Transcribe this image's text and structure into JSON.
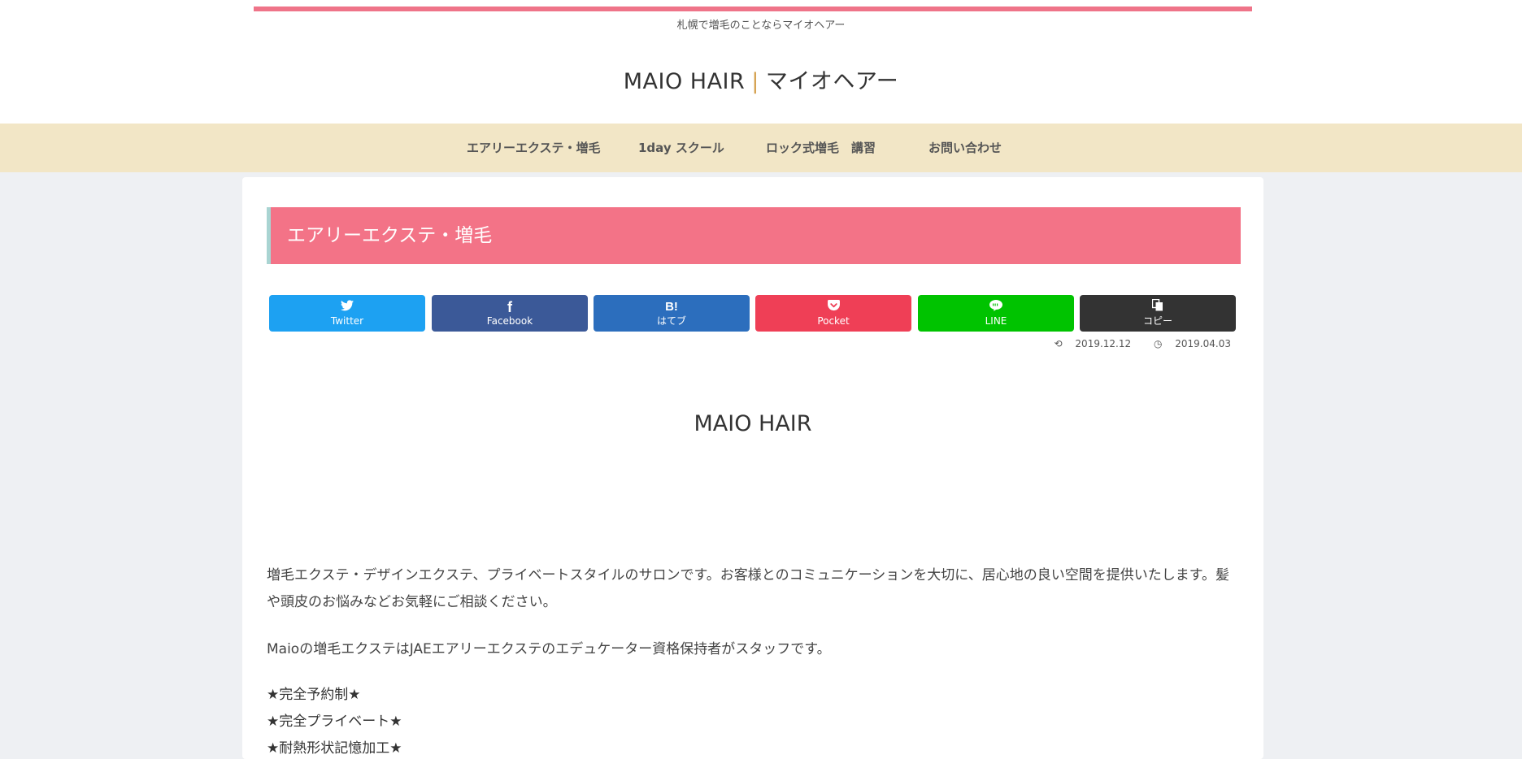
{
  "header": {
    "tagline": "札幌で増毛のことならマイオヘアー",
    "title_left": "MAIO HAIR",
    "title_sep": "|",
    "title_right": "マイオヘアー",
    "accent_color": "#ef7489"
  },
  "nav": {
    "items": [
      {
        "label": "エアリーエクステ・増毛"
      },
      {
        "label": "1day スクール"
      },
      {
        "label": "ロック式増毛　講習"
      },
      {
        "label": "お問い合わせ"
      }
    ],
    "background": "#f2e6c6"
  },
  "entry": {
    "title": "エアリーエクステ・増毛",
    "share_buttons": [
      {
        "icon": "twitter-icon",
        "glyph": "🐦",
        "label": "Twitter",
        "color": "#1da1f2"
      },
      {
        "icon": "facebook-icon",
        "glyph": "f",
        "label": "Facebook",
        "color": "#3b5998"
      },
      {
        "icon": "hatena-icon",
        "glyph": "B!",
        "label": "はてブ",
        "color": "#2c6ebd"
      },
      {
        "icon": "pocket-icon",
        "glyph": "◡",
        "label": "Pocket",
        "color": "#ef3f56"
      },
      {
        "icon": "line-icon",
        "glyph": "●",
        "label": "LINE",
        "color": "#00c300"
      },
      {
        "icon": "copy-icon",
        "glyph": "❐",
        "label": "コピー",
        "color": "#333333"
      }
    ],
    "updated_date": "2019.12.12",
    "published_date": "2019.04.03",
    "heading": "MAIO HAIR",
    "paragraph_1": "増毛エクステ・デザインエクステ、プライベートスタイルのサロンです。お客様とのコミュニケーションを大切に、居心地の良い空間を提供いたします。髪や頭皮のお悩みなどお気軽にご相談ください。",
    "paragraph_2": "Maioの増毛エクステはJAEエアリーエクステのエデュケーター資格保持者がスタッフです。",
    "features": [
      "★完全予約制★",
      "★完全プライベート★",
      "★耐熱形状記憶加工★"
    ]
  }
}
